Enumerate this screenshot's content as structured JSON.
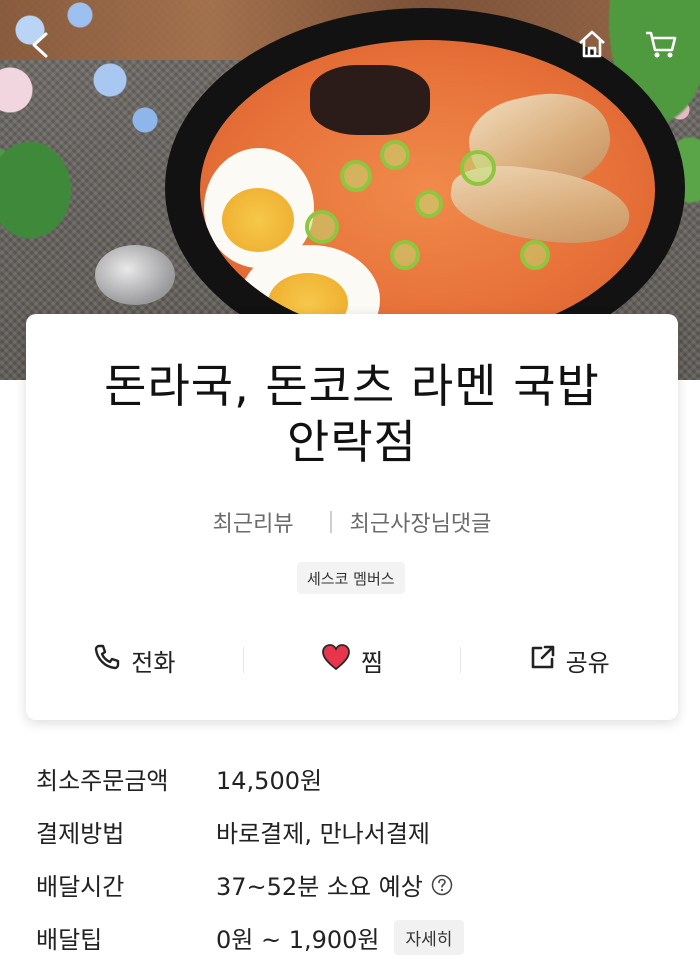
{
  "header": {
    "back_icon": "back-arrow-icon",
    "home_icon": "home-icon",
    "cart_icon": "cart-icon"
  },
  "store": {
    "title_line1": "돈라국, 돈코츠 라멘 국밥",
    "title_line2": "안락점",
    "recent_review": "최근리뷰",
    "recent_owner_reply": "최근사장님댓글",
    "badge": "세스코 멤버스"
  },
  "actions": {
    "call": "전화",
    "like": "찜",
    "share": "공유"
  },
  "info": {
    "min_order_label": "최소주문금액",
    "min_order_value": "14,500원",
    "payment_label": "결제방법",
    "payment_value": "바로결제, 만나서결제",
    "delivery_time_label": "배달시간",
    "delivery_time_value": "37~52분 소요 예상",
    "delivery_tip_label": "배달팁",
    "delivery_tip_value": "0원 ~ 1,900원",
    "detail_button": "자세히"
  },
  "colors": {
    "heart": "#e8354b",
    "text": "#222222",
    "muted": "#6b6b6b"
  }
}
